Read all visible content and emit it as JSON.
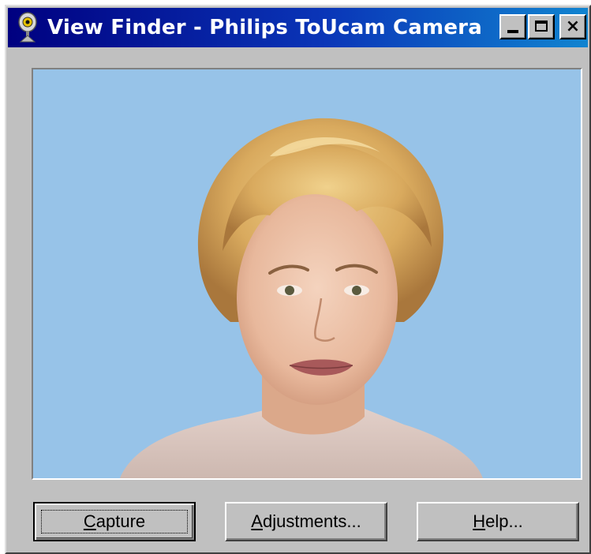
{
  "window": {
    "title": "View Finder - Philips ToUcam Camera",
    "icon": "webcam-icon",
    "controls": [
      "minimize-icon",
      "maximize-icon",
      "close-icon"
    ]
  },
  "viewport": {
    "content": "camera-preview",
    "background_color": "#97c3e8"
  },
  "buttons": {
    "capture": {
      "label": "Capture",
      "mnemonic": "C",
      "rest": "apture"
    },
    "adjustments": {
      "label": "Adjustments...",
      "mnemonic": "A",
      "rest": "djustments..."
    },
    "help": {
      "label": "Help...",
      "mnemonic": "H",
      "rest": "elp..."
    }
  },
  "colors": {
    "titlebar_start": "#000080",
    "titlebar_end": "#1084d0",
    "face": "#c0c0c0"
  }
}
